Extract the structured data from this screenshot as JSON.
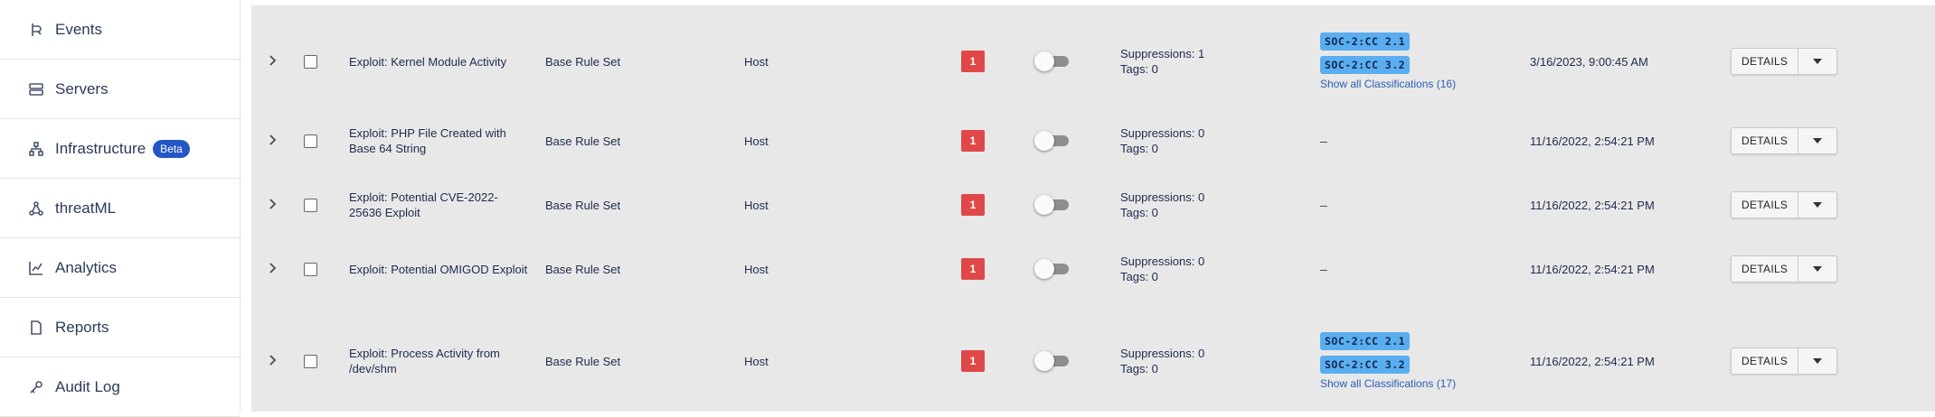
{
  "sidebar": {
    "items": [
      {
        "label": "Events",
        "icon": "events-icon"
      },
      {
        "label": "Servers",
        "icon": "servers-icon"
      },
      {
        "label": "Infrastructure",
        "icon": "infrastructure-icon",
        "badge": "Beta"
      },
      {
        "label": "threatML",
        "icon": "threatml-icon"
      },
      {
        "label": "Analytics",
        "icon": "analytics-icon"
      },
      {
        "label": "Reports",
        "icon": "reports-icon"
      },
      {
        "label": "Audit Log",
        "icon": "audit-log-icon"
      }
    ]
  },
  "table": {
    "rows": [
      {
        "name": "Exploit: Kernel Module Activity",
        "ruleset": "Base Rule Set",
        "type": "Host",
        "severity": "1",
        "suppressions": "Suppressions: 1",
        "tags": "Tags: 0",
        "classifications": [
          "SOC-2:CC 2.1",
          "SOC-2:CC 3.2"
        ],
        "show_all": "Show all Classifications (16)",
        "date": "3/16/2023, 9:00:45 AM",
        "details": "DETAILS"
      },
      {
        "name": "Exploit: PHP File Created with Base 64 String",
        "ruleset": "Base Rule Set",
        "type": "Host",
        "severity": "1",
        "suppressions": "Suppressions: 0",
        "tags": "Tags: 0",
        "dash": "–",
        "date": "11/16/2022, 2:54:21 PM",
        "details": "DETAILS"
      },
      {
        "name": "Exploit: Potential CVE-2022-25636 Exploit",
        "ruleset": "Base Rule Set",
        "type": "Host",
        "severity": "1",
        "suppressions": "Suppressions: 0",
        "tags": "Tags: 0",
        "dash": "–",
        "date": "11/16/2022, 2:54:21 PM",
        "details": "DETAILS"
      },
      {
        "name": "Exploit: Potential OMIGOD Exploit",
        "ruleset": "Base Rule Set",
        "type": "Host",
        "severity": "1",
        "suppressions": "Suppressions: 0",
        "tags": "Tags: 0",
        "dash": "–",
        "date": "11/16/2022, 2:54:21 PM",
        "details": "DETAILS"
      },
      {
        "name": "Exploit: Process Activity from /dev/shm",
        "ruleset": "Base Rule Set",
        "type": "Host",
        "severity": "1",
        "suppressions": "Suppressions: 0",
        "tags": "Tags: 0",
        "classifications": [
          "SOC-2:CC 2.1",
          "SOC-2:CC 3.2"
        ],
        "show_all": "Show all Classifications (17)",
        "date": "11/16/2022, 2:54:21 PM",
        "details": "DETAILS"
      }
    ]
  },
  "colors": {
    "accent": "#2457c5",
    "severity": "#e04848",
    "chip": "#5aaef0",
    "link": "#2a5db8",
    "table_bg": "#e8e8e8"
  }
}
